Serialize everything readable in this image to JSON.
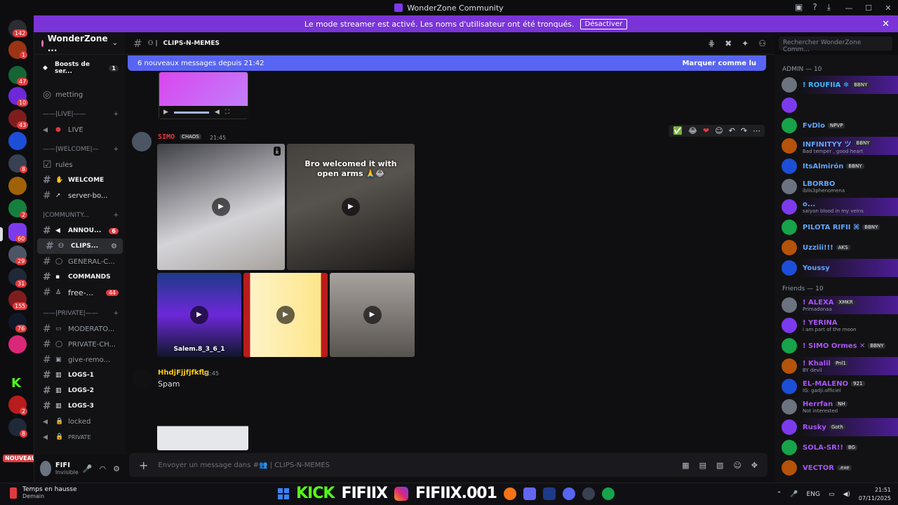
{
  "window": {
    "title": "WonderZone Community"
  },
  "banner": {
    "text": "Le mode streamer est activé. Les noms d'utilisateur ont été tronqués.",
    "button": "Désactiver"
  },
  "rail": {
    "badges": [
      "142",
      "1",
      "47",
      "10",
      "43",
      "8",
      "2",
      "60",
      "29",
      "31",
      "155",
      "76",
      "2",
      "8"
    ],
    "nouveau": "NOUVEAU",
    "kick": "K"
  },
  "server": {
    "name": "WonderZone ..."
  },
  "channels": {
    "boosts": {
      "label": "Boosts de ser...",
      "count": "1"
    },
    "metting": "metting",
    "cat_live": "——|LIVE|——",
    "live": "LIVE",
    "cat_welcome": "——|WELCOME|—",
    "rules": "rules",
    "welcome": "WELCOME",
    "server_bo": "server-bo...",
    "cat_community": "|COMMUNITY...",
    "annou": {
      "label": "ANNOU...",
      "count": "6"
    },
    "clips": "CLIPS...",
    "general": "GENERAL-C...",
    "commands": "COMMANDS",
    "free": {
      "label": "free-...",
      "count": "44"
    },
    "cat_private": "——|PRIVATE|——",
    "moderato": "MODERATO...",
    "private_ch": "PRIVATE-CH...",
    "give": "give-remo...",
    "logs1": "LOGS-1",
    "logs2": "LOGS-2",
    "logs3": "LOGS-3",
    "locked": "locked",
    "prive": "PRIVATE"
  },
  "user": {
    "name": "FIFI",
    "status": "Invisible"
  },
  "chat": {
    "channel": "CLIPS-N-MEMES",
    "newbar": {
      "text": "6 nouveaux messages depuis 21:42",
      "mark": "Marquer comme lu"
    },
    "reactions": [
      "✅",
      "😂",
      "❤"
    ],
    "messages": [
      {
        "user": "SIMO",
        "tag": "CHAOS",
        "time": "21:45",
        "captions": [
          "Bro welcomed it with",
          "open arms 🙏😂"
        ],
        "caption2": "Salem.8_3_6_1"
      },
      {
        "user": "HhdjFjjfjfkflg",
        "time": "21:45",
        "text": "Spam"
      }
    ],
    "placeholder": "Envoyer un message dans #👥 | CLIPS-N-MEMES"
  },
  "search": {
    "placeholder": "Rechercher WonderZone Comm..."
  },
  "members": {
    "admin_label": "ADMIN — 10",
    "friends_label": "Friends — 10",
    "admin": [
      {
        "name": "! ROUFIIA ❄",
        "tag": "BBNY",
        "sub": "",
        "color": "#38bdf8"
      },
      {
        "name": "",
        "tag": "",
        "sub": "",
        "color": "#a78bfa"
      },
      {
        "name": "FvDlo",
        "tag": "NPVP",
        "sub": "",
        "color": "#60a5fa"
      },
      {
        "name": "INFINITYY ツ",
        "tag": "BBNY",
        "sub": "Bad temper , good heart",
        "color": "#60a5fa"
      },
      {
        "name": "ItsAlmirón",
        "tag": "BBNY",
        "sub": "",
        "color": "#60a5fa"
      },
      {
        "name": "LBORBO",
        "tag": "",
        "sub": "iblis3phenomena",
        "color": "#60a5fa"
      },
      {
        "name": "o...",
        "tag": "",
        "sub": "saiyan blood in my veins",
        "color": "#60a5fa"
      },
      {
        "name": "PILOTA RIFII ⌘",
        "tag": "BBNY",
        "sub": "",
        "color": "#60a5fa"
      },
      {
        "name": "Uzziii!!!",
        "tag": "AKS",
        "sub": "",
        "color": "#60a5fa"
      },
      {
        "name": "Youssy",
        "tag": "",
        "sub": "",
        "color": "#60a5fa"
      }
    ],
    "friends": [
      {
        "name": "! ALEXA",
        "tag": "XMKR",
        "sub": "Primadonaa",
        "color": "#a855f7"
      },
      {
        "name": "! YERINA",
        "tag": "",
        "sub": "i am part of the moon",
        "color": "#a855f7"
      },
      {
        "name": "! SIMO Ormes ✕",
        "tag": "BBNY",
        "sub": "",
        "color": "#a855f7"
      },
      {
        "name": "! Khalil",
        "tag": "Pnl1",
        "sub": "BY devil",
        "color": "#a855f7"
      },
      {
        "name": "EL-MALENO",
        "tag": "921",
        "sub": "IG: gadji.officiel",
        "color": "#a855f7"
      },
      {
        "name": "Herrfan",
        "tag": "NH",
        "sub": "Not interested",
        "color": "#a855f7"
      },
      {
        "name": "Rusky",
        "tag": "Goth",
        "sub": "",
        "color": "#a855f7"
      },
      {
        "name": "SOLA-SR!!",
        "tag": "BG",
        "sub": "",
        "color": "#a855f7"
      },
      {
        "name": "VECTOR",
        "tag": ".exe",
        "sub": "",
        "color": "#a855f7"
      }
    ]
  },
  "taskbar": {
    "weather_title": "Temps en hausse",
    "weather_sub": "Demain",
    "brand_kick": "KICK",
    "brand_name1": "FIFIIX",
    "brand_name2": "FIFIIX.001",
    "lang": "ENG",
    "time": "21:51",
    "date": "07/11/2025"
  },
  "colors": {
    "accent": "#5865f2",
    "banner": "#7a34d8",
    "brand_kick": "#53fc18"
  }
}
